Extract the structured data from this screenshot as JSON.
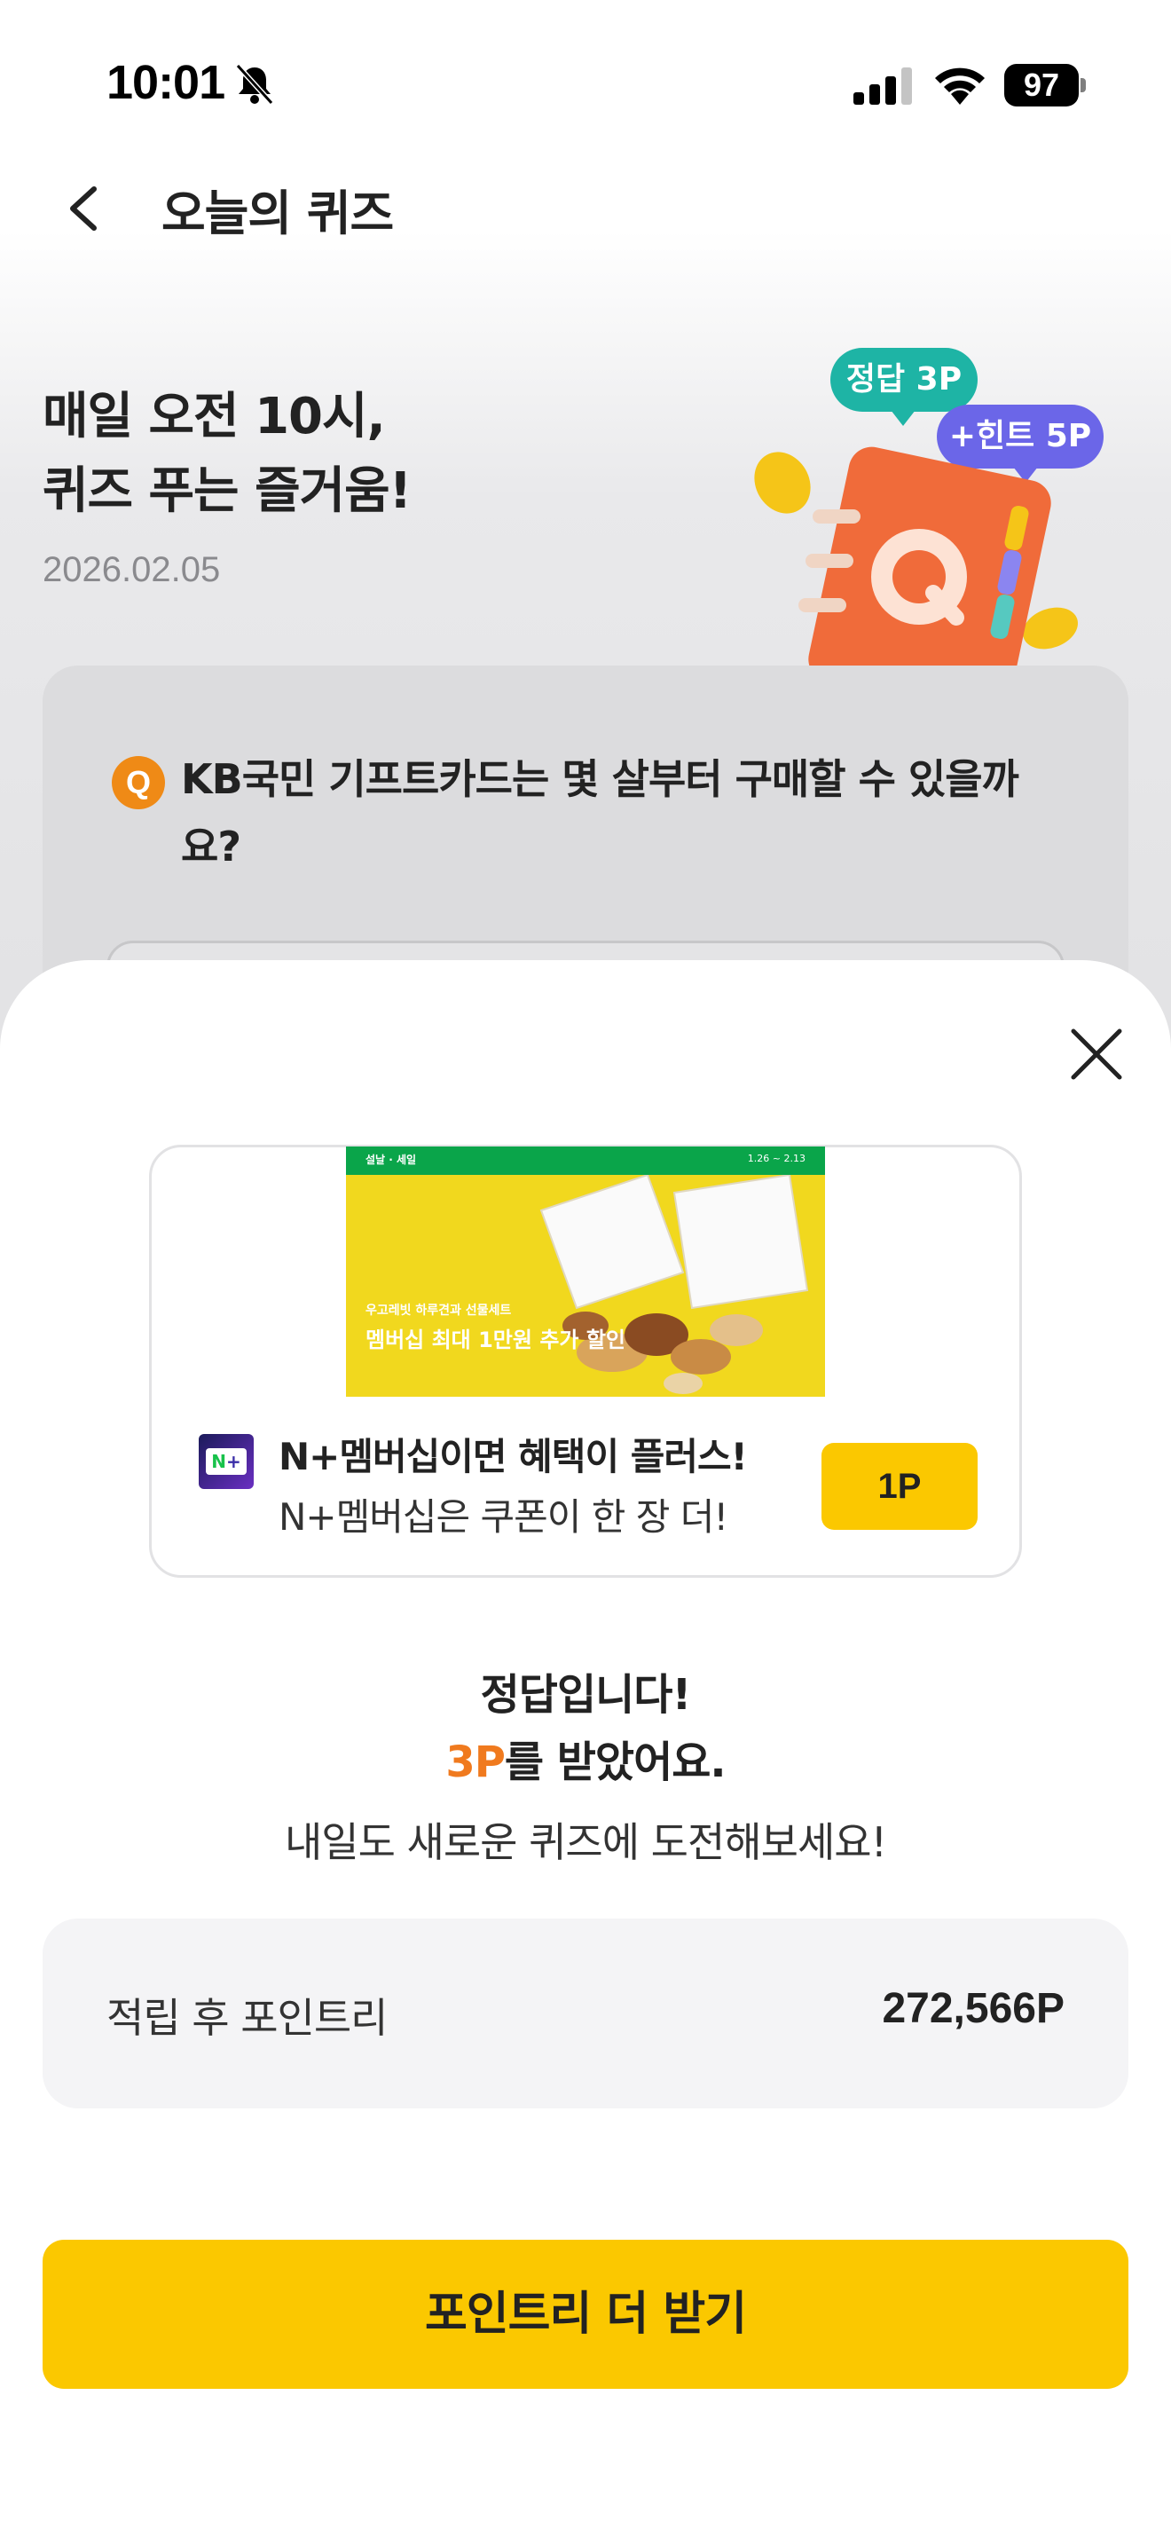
{
  "status_bar": {
    "time": "10:01",
    "battery": "97"
  },
  "header": {
    "title": "오늘의 퀴즈"
  },
  "intro": {
    "line1": "매일 오전 10시,",
    "line2": "퀴즈 푸는 즐거움!",
    "date": "2026.02.05"
  },
  "badges": {
    "correct": "정답 3P",
    "hint": "+힌트 5P"
  },
  "question": {
    "badge": "Q",
    "text": "KB국민 기프트카드는 몇 살부터 구매할 수 있을까요?"
  },
  "ad": {
    "banner_tag": "설날 · 세일",
    "banner_date": "1.26 ~ 2.13",
    "banner_sub": "우고레빗 하루견과 선물세트",
    "banner_title": "멤버십 최대 1만원 추가 할인",
    "title": "N+멤버십이면 혜택이 플러스!",
    "desc": "N+멤버십은 쿠폰이 한 장 더!",
    "point_label": "1P"
  },
  "result": {
    "line1": "정답입니다!",
    "points": "3P",
    "line2_suffix": "를 받았어요.",
    "line3": "내일도 새로운 퀴즈에 도전해보세요!"
  },
  "balance": {
    "label": "적립 후 포인트리",
    "value": "272,566P"
  },
  "cta": {
    "label": "포인트리 더 받기"
  },
  "colors": {
    "accent_yellow": "#fbc800",
    "accent_orange": "#f07a1e",
    "teal": "#1eb4a5",
    "purple": "#6b66e8"
  }
}
